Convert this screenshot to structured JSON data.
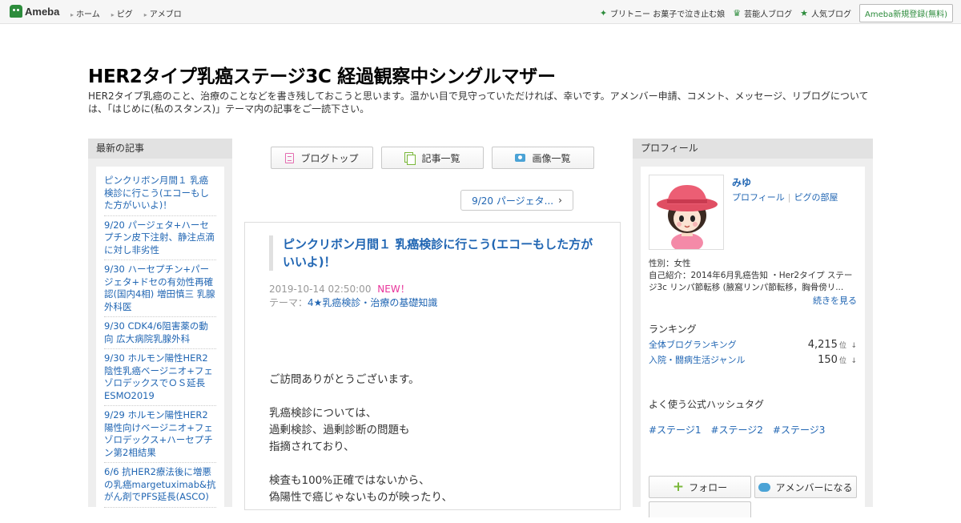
{
  "header": {
    "logo": "Ameba",
    "nav": [
      "ホーム",
      "ピグ",
      "アメブロ"
    ],
    "links": [
      "ブリトニー お菓子で泣き止む娘",
      "芸能人ブログ",
      "人気ブログ"
    ],
    "register": "Ameba新規登録(無料)"
  },
  "blog": {
    "title": "HER2タイプ乳癌ステージ3C 経過観察中シングルマザー",
    "description": "HER2タイプ乳癌のこと、治療のことなどを書き残しておこうと思います。温かい目で見守っていただければ、幸いです。アメンバー申請、コメント、メッセージ、リブログについては、「はじめに(私のスタンス)」テーマ内の記事をご一読下さい。"
  },
  "left": {
    "heading": "最新の記事",
    "entries": [
      "ピンクリボン月間１ 乳癌検診に行こう(エコーもした方がいいよ)！",
      "9/20 パージェタ+ハーセプチン皮下注射、静注点滴に対し非劣性",
      "9/30 ハーセプチン+パージェタ+ドセの有効性再確認(国内4相) 増田慎三 乳腺外科医",
      "9/30 CDK4/6阻害薬の動向 広大病院乳腺外科",
      "9/30 ホルモン陽性HER2陰性乳癌ベージニオ+フェゾロデックスでＯＳ延長 ESMO2019",
      "9/29 ホルモン陽性HER2陽性向けベージニオ+フェゾロデックス+ハーセプチン第2相結果",
      "6/6 抗HER2療法後に増悪の乳癌margetuximab&抗がん剤でPFS延長(ASCO)"
    ]
  },
  "center": {
    "nav": {
      "blog_top": "ブログトップ",
      "articles": "記事一覧",
      "images": "画像一覧"
    },
    "pager": "9/20 パージェタ...",
    "article": {
      "title": "ピンクリボン月間１ 乳癌検診に行こう(エコーもした方がいいよ)！",
      "date": "2019-10-14 02:50:00",
      "new_badge": "NEW！",
      "theme_label": "テーマ：",
      "theme": "4★乳癌検診・治療の基礎知識",
      "body": {
        "p1": "ご訪問ありがとうございます。",
        "p2_l1": "乳癌検診については、",
        "p2_l2": "過剰検診、過剰診断の問題も",
        "p2_l3": "指摘されており、",
        "p3_l1": "検査も100%正確ではないから、",
        "p3_l2": "偽陽性で癌じゃないものが映ったり、"
      }
    }
  },
  "right": {
    "heading": "プロフィール",
    "name": "みゆ",
    "links": [
      "プロフィール",
      "ピグの部屋"
    ],
    "gender": "性別：女性",
    "intro": "自己紹介：2014年6月乳癌告知 ・Her2タイプ ステージ3c リンパ節転移 (腋窩リンパ節転移，胸骨傍リ...",
    "more": "続きを見る",
    "ranking_heading": "ランキング",
    "rankings": [
      {
        "name": "全体ブログランキング",
        "value": "4,215",
        "unit": "位",
        "trend": "↓"
      },
      {
        "name": "入院・闘病生活ジャンル",
        "value": "150",
        "unit": "位",
        "trend": "↓"
      }
    ],
    "hashtag_heading": "よく使う公式ハッシュタグ",
    "hashtags": [
      "#ステージ1",
      "#ステージ2",
      "#ステージ3"
    ],
    "follow": "フォロー",
    "amember": "アメンバーになる"
  }
}
